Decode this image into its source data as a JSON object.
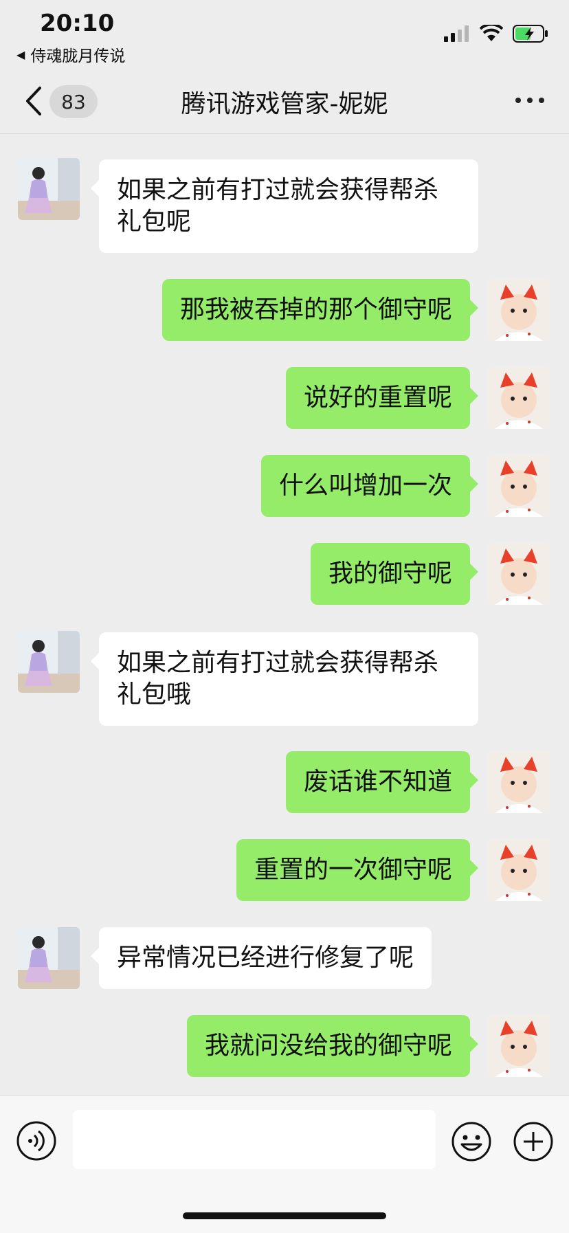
{
  "status_bar": {
    "time": "20:10",
    "back_app": "侍魂胧月传说"
  },
  "nav": {
    "unread_count": "83",
    "title": "腾讯游戏管家-妮妮"
  },
  "messages": [
    {
      "side": "in",
      "text": "如果之前有打过就会获得帮杀礼包呢"
    },
    {
      "side": "out",
      "text": "那我被吞掉的那个御守呢"
    },
    {
      "side": "out",
      "text": "说好的重置呢"
    },
    {
      "side": "out",
      "text": "什么叫增加一次"
    },
    {
      "side": "out",
      "text": "我的御守呢"
    },
    {
      "side": "in",
      "text": "如果之前有打过就会获得帮杀礼包哦"
    },
    {
      "side": "out",
      "text": "废话谁不知道"
    },
    {
      "side": "out",
      "text": "重置的一次御守呢"
    },
    {
      "side": "in",
      "text": "异常情况已经进行修复了呢"
    },
    {
      "side": "out",
      "text": "我就问没给我的御守呢"
    }
  ],
  "input": {
    "value": "",
    "placeholder": ""
  },
  "colors": {
    "outgoing_bubble": "#95ec69",
    "incoming_bubble": "#ffffff",
    "background": "#ededed"
  }
}
